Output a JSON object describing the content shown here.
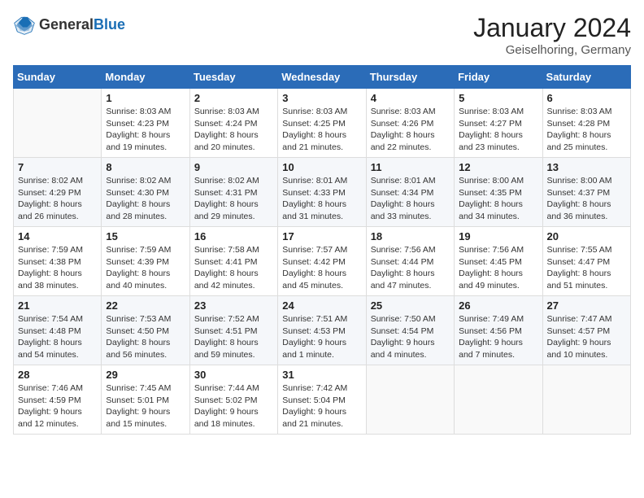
{
  "header": {
    "logo_general": "General",
    "logo_blue": "Blue",
    "month": "January 2024",
    "location": "Geiselhoring, Germany"
  },
  "days_of_week": [
    "Sunday",
    "Monday",
    "Tuesday",
    "Wednesday",
    "Thursday",
    "Friday",
    "Saturday"
  ],
  "weeks": [
    [
      {
        "day": "",
        "info": ""
      },
      {
        "day": "1",
        "info": "Sunrise: 8:03 AM\nSunset: 4:23 PM\nDaylight: 8 hours\nand 19 minutes."
      },
      {
        "day": "2",
        "info": "Sunrise: 8:03 AM\nSunset: 4:24 PM\nDaylight: 8 hours\nand 20 minutes."
      },
      {
        "day": "3",
        "info": "Sunrise: 8:03 AM\nSunset: 4:25 PM\nDaylight: 8 hours\nand 21 minutes."
      },
      {
        "day": "4",
        "info": "Sunrise: 8:03 AM\nSunset: 4:26 PM\nDaylight: 8 hours\nand 22 minutes."
      },
      {
        "day": "5",
        "info": "Sunrise: 8:03 AM\nSunset: 4:27 PM\nDaylight: 8 hours\nand 23 minutes."
      },
      {
        "day": "6",
        "info": "Sunrise: 8:03 AM\nSunset: 4:28 PM\nDaylight: 8 hours\nand 25 minutes."
      }
    ],
    [
      {
        "day": "7",
        "info": "Sunrise: 8:02 AM\nSunset: 4:29 PM\nDaylight: 8 hours\nand 26 minutes."
      },
      {
        "day": "8",
        "info": "Sunrise: 8:02 AM\nSunset: 4:30 PM\nDaylight: 8 hours\nand 28 minutes."
      },
      {
        "day": "9",
        "info": "Sunrise: 8:02 AM\nSunset: 4:31 PM\nDaylight: 8 hours\nand 29 minutes."
      },
      {
        "day": "10",
        "info": "Sunrise: 8:01 AM\nSunset: 4:33 PM\nDaylight: 8 hours\nand 31 minutes."
      },
      {
        "day": "11",
        "info": "Sunrise: 8:01 AM\nSunset: 4:34 PM\nDaylight: 8 hours\nand 33 minutes."
      },
      {
        "day": "12",
        "info": "Sunrise: 8:00 AM\nSunset: 4:35 PM\nDaylight: 8 hours\nand 34 minutes."
      },
      {
        "day": "13",
        "info": "Sunrise: 8:00 AM\nSunset: 4:37 PM\nDaylight: 8 hours\nand 36 minutes."
      }
    ],
    [
      {
        "day": "14",
        "info": "Sunrise: 7:59 AM\nSunset: 4:38 PM\nDaylight: 8 hours\nand 38 minutes."
      },
      {
        "day": "15",
        "info": "Sunrise: 7:59 AM\nSunset: 4:39 PM\nDaylight: 8 hours\nand 40 minutes."
      },
      {
        "day": "16",
        "info": "Sunrise: 7:58 AM\nSunset: 4:41 PM\nDaylight: 8 hours\nand 42 minutes."
      },
      {
        "day": "17",
        "info": "Sunrise: 7:57 AM\nSunset: 4:42 PM\nDaylight: 8 hours\nand 45 minutes."
      },
      {
        "day": "18",
        "info": "Sunrise: 7:56 AM\nSunset: 4:44 PM\nDaylight: 8 hours\nand 47 minutes."
      },
      {
        "day": "19",
        "info": "Sunrise: 7:56 AM\nSunset: 4:45 PM\nDaylight: 8 hours\nand 49 minutes."
      },
      {
        "day": "20",
        "info": "Sunrise: 7:55 AM\nSunset: 4:47 PM\nDaylight: 8 hours\nand 51 minutes."
      }
    ],
    [
      {
        "day": "21",
        "info": "Sunrise: 7:54 AM\nSunset: 4:48 PM\nDaylight: 8 hours\nand 54 minutes."
      },
      {
        "day": "22",
        "info": "Sunrise: 7:53 AM\nSunset: 4:50 PM\nDaylight: 8 hours\nand 56 minutes."
      },
      {
        "day": "23",
        "info": "Sunrise: 7:52 AM\nSunset: 4:51 PM\nDaylight: 8 hours\nand 59 minutes."
      },
      {
        "day": "24",
        "info": "Sunrise: 7:51 AM\nSunset: 4:53 PM\nDaylight: 9 hours\nand 1 minute."
      },
      {
        "day": "25",
        "info": "Sunrise: 7:50 AM\nSunset: 4:54 PM\nDaylight: 9 hours\nand 4 minutes."
      },
      {
        "day": "26",
        "info": "Sunrise: 7:49 AM\nSunset: 4:56 PM\nDaylight: 9 hours\nand 7 minutes."
      },
      {
        "day": "27",
        "info": "Sunrise: 7:47 AM\nSunset: 4:57 PM\nDaylight: 9 hours\nand 10 minutes."
      }
    ],
    [
      {
        "day": "28",
        "info": "Sunrise: 7:46 AM\nSunset: 4:59 PM\nDaylight: 9 hours\nand 12 minutes."
      },
      {
        "day": "29",
        "info": "Sunrise: 7:45 AM\nSunset: 5:01 PM\nDaylight: 9 hours\nand 15 minutes."
      },
      {
        "day": "30",
        "info": "Sunrise: 7:44 AM\nSunset: 5:02 PM\nDaylight: 9 hours\nand 18 minutes."
      },
      {
        "day": "31",
        "info": "Sunrise: 7:42 AM\nSunset: 5:04 PM\nDaylight: 9 hours\nand 21 minutes."
      },
      {
        "day": "",
        "info": ""
      },
      {
        "day": "",
        "info": ""
      },
      {
        "day": "",
        "info": ""
      }
    ]
  ]
}
